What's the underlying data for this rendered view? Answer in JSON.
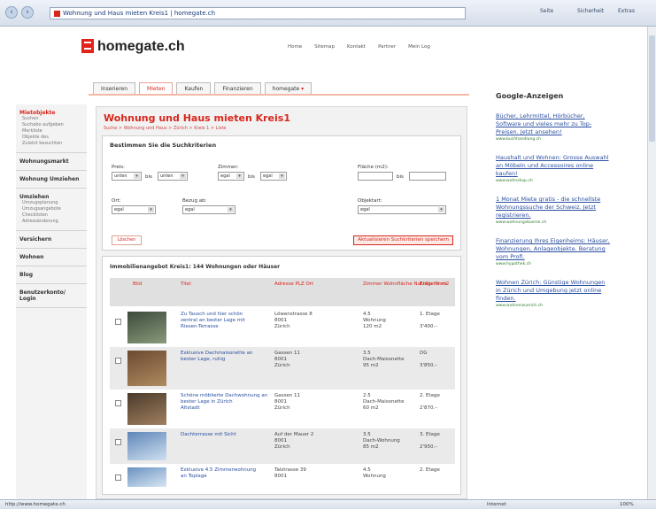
{
  "browser": {
    "url": "Wohnung und Haus mieten Kreis1 | homegate.ch",
    "toolbar": [
      "Seite",
      "Sicherheit",
      "Extras"
    ],
    "status_url": "http://www.homegate.ch",
    "status_zone": "Internet",
    "zoom": "100%"
  },
  "site": {
    "logo": "homegate.ch",
    "toplinks": [
      "Home",
      "Sitemap",
      "Kontakt",
      "Partner",
      "Mein Log"
    ],
    "tabs": [
      "Inserieren",
      "Mieten",
      "Kaufen",
      "Finanzieren",
      "homegate"
    ]
  },
  "sidebar": {
    "groups": [
      {
        "title": "Mietobjekte",
        "red": true,
        "subs": [
          "Suchen",
          "Suchabo aufgeben",
          "Merkliste",
          "Objekte des",
          "Zuletzt besuchten"
        ]
      },
      {
        "title": "Wohnungsmarkt",
        "red": false,
        "subs": []
      },
      {
        "title": "Wohnung Umziehen",
        "red": false,
        "subs": []
      },
      {
        "title": "Umziehen",
        "red": false,
        "subs": [
          "Umzugsplanung",
          "Umzugsangebote",
          "Checklisten",
          "Adressänderung"
        ]
      },
      {
        "title": "Versichern",
        "red": false,
        "subs": []
      },
      {
        "title": "Wohnen",
        "red": false,
        "subs": []
      },
      {
        "title": "Blog",
        "red": false,
        "subs": []
      },
      {
        "title": "Benutzerkonto/ Login",
        "red": false,
        "subs": []
      }
    ]
  },
  "main": {
    "heading": "Wohnung und Haus mieten Kreis1",
    "breadcrumb": "Suche > Wohnung und Haus > Zürich > Kreis 1 > Liste",
    "search": {
      "title": "Bestimmen Sie die Suchkriterien",
      "labels": {
        "preis": "Preis:",
        "zimmer": "Zimmer:",
        "flaeche": "Fläche (m2):",
        "bis": "bis",
        "ort": "Ort:",
        "bezug": "Bezug ab:",
        "objektart": "Objektart:"
      },
      "values": {
        "preis_von": "unten",
        "preis_bis": "unten",
        "zimmer_von": "egal",
        "zimmer_bis": "egal",
        "ort": "egal",
        "bezug": "egal",
        "objektart": "egal"
      },
      "reset_label": "Löschen",
      "save_label": "Aktualisieren Suchkriterien speichern"
    },
    "results": {
      "title": "Immobilienangebot Kreis1: 144 Wohnungen oder Häuser",
      "columns": [
        "Bild",
        "Titel",
        "Adresse\nPLZ\nOrt",
        "Zimmer\nWohnfläche\nNutzfläche m2",
        "Etage\nPreis"
      ],
      "rows": [
        {
          "title": "Zu Tausch und hier schön\nzentral an bester Lage mit\nRiesen-Terrasse",
          "address": "Löwenstrasse 8\n8001\nZürich",
          "rooms": "4.5\nWohnung\n120 m2",
          "price": "1. Etage\n\n3'400.–"
        },
        {
          "title": "Exklusive Dachmaisonette an\nbester Lage, ruhig",
          "address": "Gassen 11\n8001\nZürich",
          "rooms": "3.5\nDach-Maisonette\n95 m2",
          "price": "DG\n\n3'850.–"
        },
        {
          "title": "Schöne möblierte Dachwohnung an\nbester Lage in Zürich\nAltstadt",
          "address": "Gassen 11\n8001\nZürich",
          "rooms": "2.5\nDach-Maisonette\n60 m2",
          "price": "2. Etage\n\n2'870.–"
        },
        {
          "title": "Dachterrasse mit Sicht",
          "address": "Auf der Mauer 2\n8001\nZürich",
          "rooms": "3.5\nDach-Wohnung\n85 m2",
          "price": "3. Etage\n\n2'950.–"
        },
        {
          "title": "Exklusive 4.5 Zimmerwohnung\nan Toplage",
          "address": "Talstrasse 39\n8001",
          "rooms": "4.5\nWohnung",
          "price": "2. Etage"
        }
      ]
    }
  },
  "ads": {
    "brand": "Google-Anzeigen",
    "items": [
      {
        "text": "Bücher, Lehrmittel, Hörbücher, Software und vieles mehr zu Top-Preisen. Jetzt ansehen!",
        "url": "www.buchhandlung.ch"
      },
      {
        "text": "Haushalt und Wohnen: Grosse Auswahl an Möbeln und Accessoires online kaufen!",
        "url": "www.wohnshop.ch"
      },
      {
        "text": "1 Monat Miete gratis - die schnellste Wohnungssuche der Schweiz. Jetzt registrieren.",
        "url": "www.wohnungsboerse.ch"
      },
      {
        "text": "Finanzierung Ihres Eigenheims: Häuser, Wohnungen, Anlageobjekte. Beratung vom Profi.",
        "url": "www.hypothek.ch"
      },
      {
        "text": "Wohnen Zürich: Günstige Wohnungen in Zürich und Umgebung jetzt online finden.",
        "url": "www.wohnenzuerich.ch"
      }
    ]
  }
}
